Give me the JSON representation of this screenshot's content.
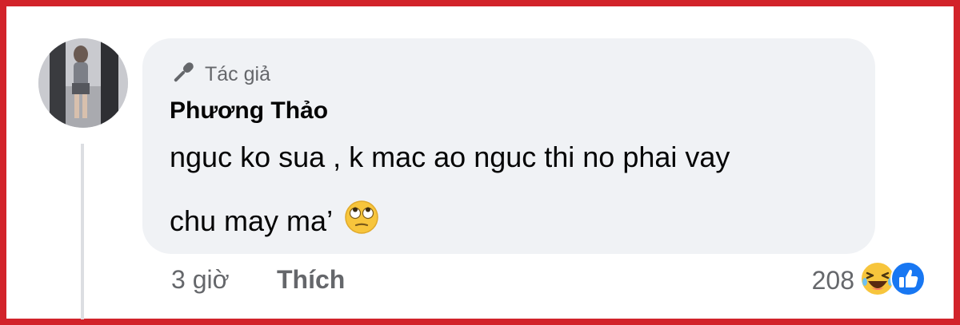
{
  "comment": {
    "badge_label": "Tác giả",
    "author_name": "Phương Thảo",
    "text_line1": "nguc ko sua , k mac ao nguc thi no phai vay",
    "text_line2": "chu may ma’",
    "emoji": "face-with-rolling-eyes"
  },
  "footer": {
    "time": "3 giờ",
    "like_label": "Thích",
    "reaction_count": "208",
    "reaction_icons": [
      "laughing-face",
      "thumbs-up"
    ]
  },
  "colors": {
    "frame_border": "#d2232a",
    "bubble_bg": "#f0f2f5",
    "muted_text": "#65676b",
    "like_blue": "#1877f2"
  }
}
